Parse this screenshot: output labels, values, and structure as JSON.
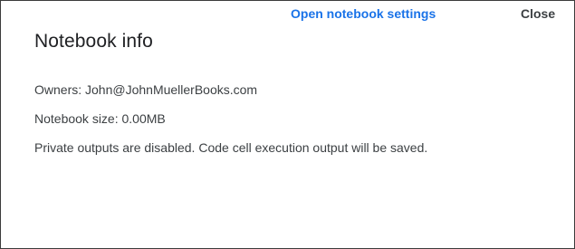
{
  "dialog": {
    "title": "Notebook info",
    "owners": "Owners: John@JohnMuellerBooks.com",
    "size": "Notebook size: 0.00MB",
    "private_outputs": "Private outputs are disabled. Code cell execution output will be saved.",
    "actions": {
      "settings_label": "Open notebook settings",
      "close_label": "Close"
    }
  },
  "colors": {
    "accent": "#1a73e8",
    "text": "#3c4043",
    "title": "#202124",
    "border": "#3c3c3c"
  }
}
